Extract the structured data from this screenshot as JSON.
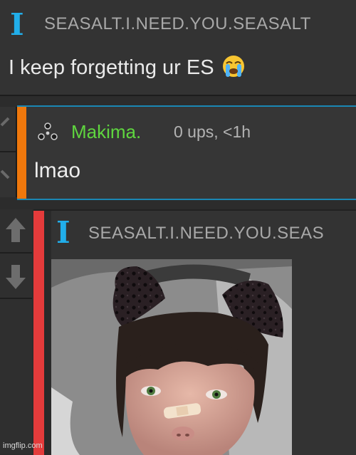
{
  "comment_top": {
    "username": "SEASALT.I.NEED.YOU.SEASALT",
    "text": "I keep forgetting ur ES",
    "emoji_icon": "loudly-crying-face-icon"
  },
  "comment_middle": {
    "username": "Makima.",
    "meta": "0 ups, <1h",
    "text": "lmao",
    "accent_color": "#f0780c",
    "username_color": "#5fd63f"
  },
  "comment_bottom": {
    "username": "SEASALT.I.NEED.YOU.SEAS",
    "accent_color": "#e43b3b",
    "image_icon": "selfie-photo"
  },
  "watermark": "imgflip.com"
}
